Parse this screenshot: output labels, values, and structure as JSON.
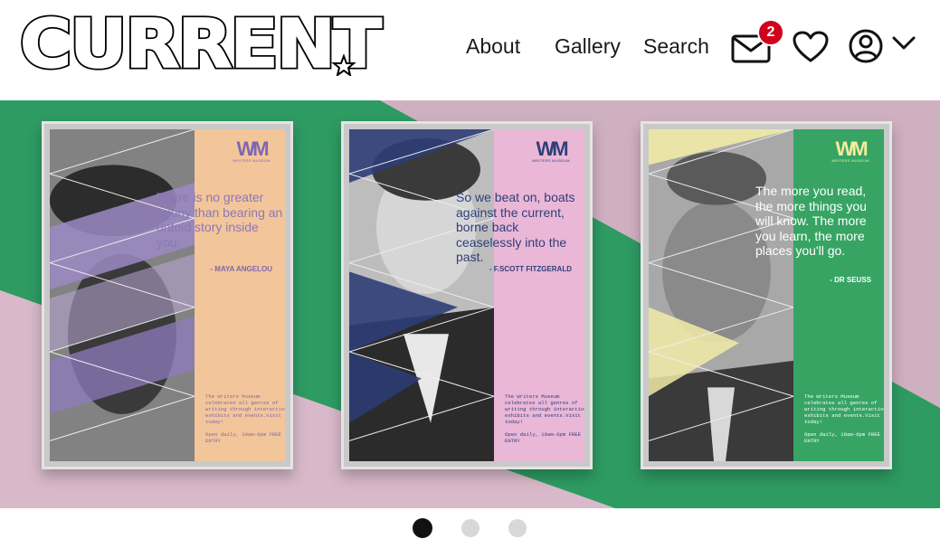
{
  "brand": {
    "logo_text": "CURRENT"
  },
  "nav": {
    "about": "About",
    "gallery": "Gallery",
    "search": "Search"
  },
  "notifications": {
    "count": "2"
  },
  "icons": {
    "mail": "envelope-icon",
    "heart": "heart-icon",
    "user": "user-circle-icon",
    "chevron": "chevron-down-icon"
  },
  "colors": {
    "badge": "#d0021b",
    "hero_green": "#2e9b63",
    "hero_pink": "#d2b2c3"
  },
  "hero": {
    "posters": [
      {
        "logo": "WM",
        "logo_sub": "WRITERS MUSEUM",
        "quote": "There is no greater agony than bearing an untold story inside you.",
        "author": "- MAYA ANGELOU",
        "info": "The Writers Museum celebrates all genres of writing through interactive exhibits and events.Visit today!",
        "open": "Open daily, 10am-6pm FREE ENTRY"
      },
      {
        "logo": "WM",
        "logo_sub": "WRITERS MUSEUM",
        "quote": "So we beat on, boats against the current, borne back ceaselessly into the past.",
        "author": "- F.SCOTT FITZGERALD",
        "info": "The Writers Museum celebrates all genres of writing through interactive exhibits and events.Visit today!",
        "open": "Open daily, 10am-6pm FREE ENTRY"
      },
      {
        "logo": "WM",
        "logo_sub": "WRITERS MUSEUM",
        "quote": "The more you read, the more things you will know. The more you learn, the more places you'll go.",
        "author": "- DR SEUSS",
        "info": "The Writers Museum celebrates all genres of writing through interactive exhibits and events.Visit today!",
        "open": "Open daily, 10am-6pm FREE ENTRY"
      }
    ]
  },
  "carousel": {
    "total": 3,
    "active": 1
  }
}
